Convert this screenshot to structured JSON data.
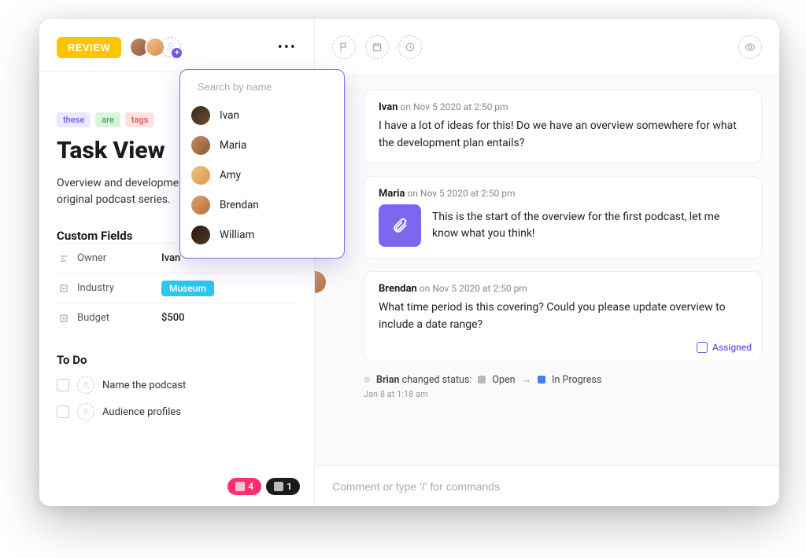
{
  "header": {
    "status_label": "REVIEW"
  },
  "search": {
    "placeholder": "Search by name"
  },
  "people": [
    {
      "name": "Ivan"
    },
    {
      "name": "Maria"
    },
    {
      "name": "Amy"
    },
    {
      "name": "Brendan"
    },
    {
      "name": "William"
    }
  ],
  "tags": [
    "these",
    "are",
    "tags"
  ],
  "task": {
    "title": "Task View",
    "description": "Overview and development plan for our first original podcast series."
  },
  "custom_fields": {
    "section": "Custom Fields",
    "rows": [
      {
        "label": "Owner",
        "value": "Ivan"
      },
      {
        "label": "Industry",
        "value": "Museum"
      },
      {
        "label": "Budget",
        "value": "$500"
      }
    ]
  },
  "todo": {
    "section": "To Do",
    "items": [
      "Name the podcast",
      "Audience profiles"
    ]
  },
  "integrations": [
    {
      "count": "4"
    },
    {
      "count": "1"
    }
  ],
  "conversation": [
    {
      "author": "Ivan",
      "ts": "on Nov 5 2020 at 2:50 pm",
      "body": "I have a lot of ideas for this! Do we have an overview somewhere for what the development plan entails?"
    },
    {
      "author": "Maria",
      "ts": "on Nov 5 2020 at 2:50 pm",
      "body": "This is the start of the overview for the first podcast, let me know what you think!",
      "attachment": true
    },
    {
      "author": "Brendan",
      "ts": "on Nov 5 2020 at 2:50 pm",
      "body": "What time period is this covering? Could you please update overview to include a date range?",
      "assigned_label": "Assigned"
    }
  ],
  "status_event": {
    "actor": "Brian",
    "verb": "changed status:",
    "from": "Open",
    "to": "In Progress",
    "ts": "Jan 8 at 1:18 am"
  },
  "composer": {
    "placeholder": "Comment or type '/' for commands"
  }
}
